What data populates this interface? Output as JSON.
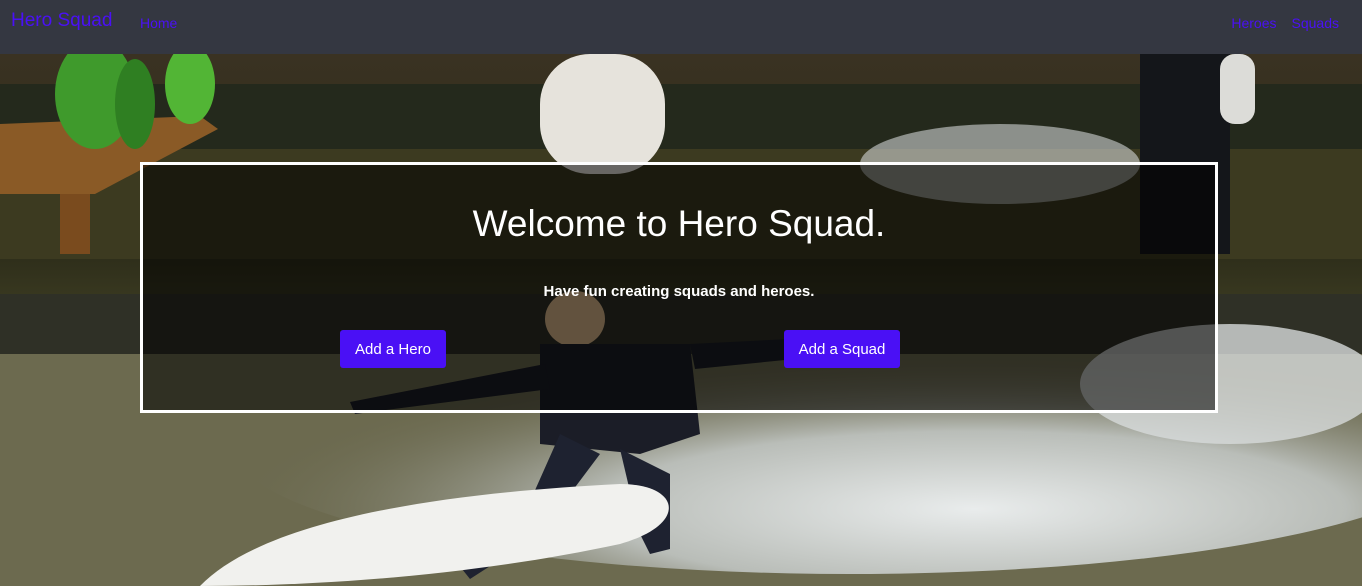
{
  "navbar": {
    "brand": "Hero Squad",
    "home_label": "Home",
    "right_links": [
      "Heroes",
      "Squads"
    ]
  },
  "hero_image": {
    "description_icon": "surfer-photo"
  },
  "welcome": {
    "title": "Welcome to Hero Squad.",
    "subtitle": "Have fun creating squads and heroes.",
    "add_hero_label": "Add a Hero",
    "add_squad_label": "Add a Squad"
  },
  "colors": {
    "navbar_bg": "#343741",
    "accent": "#4a10f5",
    "text_light": "#ffffff"
  }
}
